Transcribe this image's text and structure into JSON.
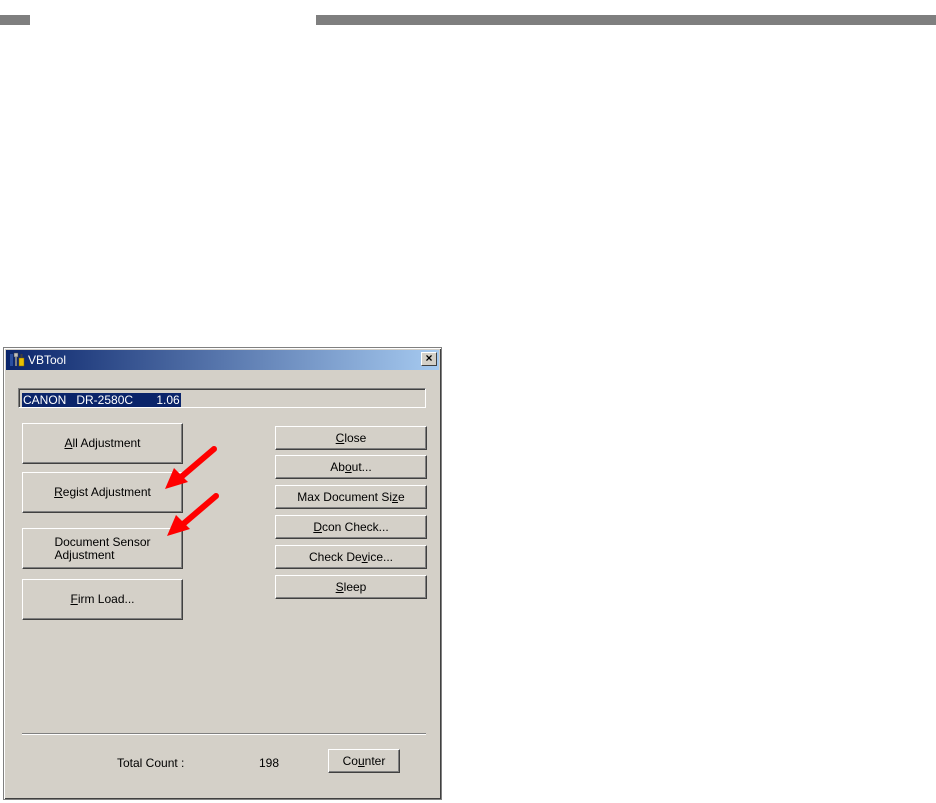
{
  "window": {
    "title": "VBTool",
    "close_glyph": "×"
  },
  "device": {
    "info": "CANON   DR-2580C       1.06"
  },
  "left_buttons": [
    {
      "pre": "",
      "u": "A",
      "post": "ll Adjustment"
    },
    {
      "pre": "",
      "u": "R",
      "post": "egist Adjustment"
    },
    {
      "line1": "Document Sensor",
      "line2": "Adjustment"
    },
    {
      "pre": "",
      "u": "F",
      "post": "irm Load..."
    }
  ],
  "right_buttons": [
    {
      "pre": "",
      "u": "C",
      "post": "lose"
    },
    {
      "pre": "Ab",
      "u": "o",
      "post": "ut..."
    },
    {
      "pre": "Max Document Si",
      "u": "z",
      "post": "e"
    },
    {
      "pre": "",
      "u": "D",
      "post": "con Check..."
    },
    {
      "pre": "Check De",
      "u": "v",
      "post": "ice..."
    },
    {
      "pre": "",
      "u": "S",
      "post": "leep"
    }
  ],
  "footer": {
    "total_label": "Total Count :",
    "total_value": "198",
    "counter": {
      "pre": "Co",
      "u": "u",
      "post": "nter"
    }
  },
  "colors": {
    "titlebar_start": "#0a246a",
    "titlebar_end": "#a6caf0",
    "face": "#d4d0c8",
    "arrow": "#ff0000"
  }
}
